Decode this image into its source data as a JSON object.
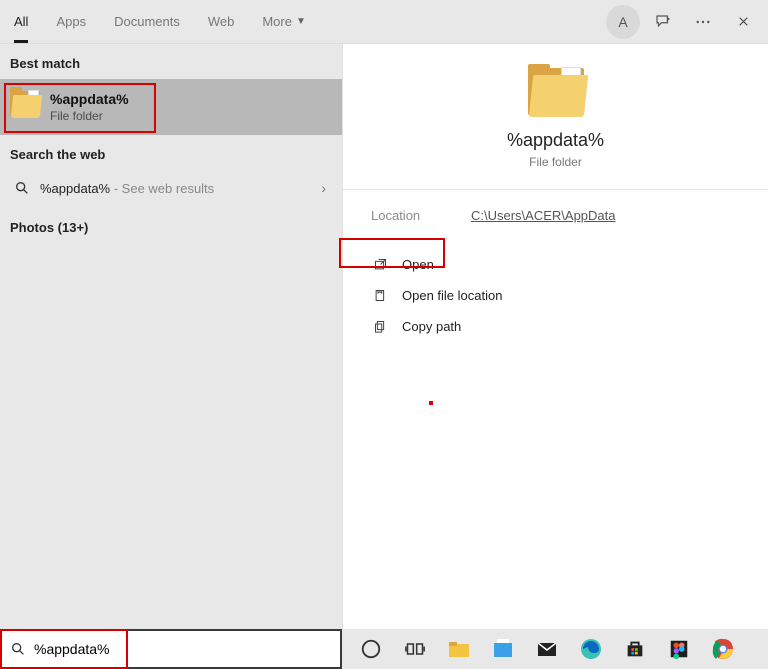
{
  "header": {
    "tabs": [
      "All",
      "Apps",
      "Documents",
      "Web",
      "More"
    ],
    "avatar_letter": "A"
  },
  "left": {
    "best_match_label": "Best match",
    "result_title": "%appdata%",
    "result_sub": "File folder",
    "search_web_label": "Search the web",
    "web_query": "%appdata%",
    "web_suffix": " - See web results",
    "photos_label": "Photos (13+)"
  },
  "right": {
    "title": "%appdata%",
    "sub": "File folder",
    "location_label": "Location",
    "location_value": "C:\\Users\\ACER\\AppData",
    "actions": [
      "Open",
      "Open file location",
      "Copy path"
    ]
  },
  "search": {
    "value": "%appdata%"
  }
}
